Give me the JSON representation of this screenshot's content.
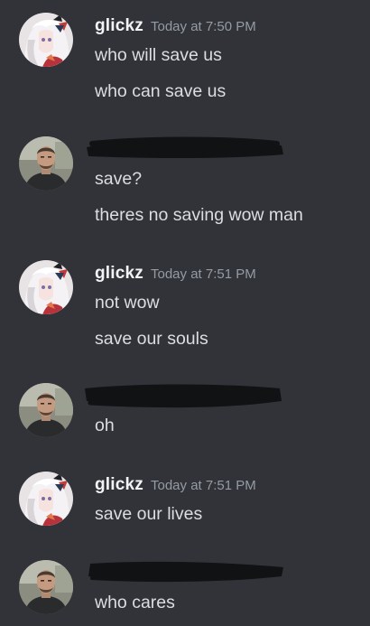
{
  "messages": [
    {
      "author": "glickz",
      "timestamp": "Today at 7:50 PM",
      "avatar": "anime-character-avatar-icon",
      "lines": [
        "who will save us",
        "who can save us"
      ]
    },
    {
      "author": "",
      "timestamp": "",
      "avatar": "man-photo-avatar-icon",
      "lines": [
        "save?",
        "theres no saving wow man"
      ]
    },
    {
      "author": "glickz",
      "timestamp": "Today at 7:51 PM",
      "avatar": "anime-character-avatar-icon",
      "lines": [
        "not wow",
        "save our souls"
      ]
    },
    {
      "author": "",
      "timestamp": "",
      "avatar": "man-photo-avatar-icon",
      "lines": [
        "oh"
      ]
    },
    {
      "author": "glickz",
      "timestamp": "Today at 7:51 PM",
      "avatar": "anime-character-avatar-icon",
      "lines": [
        "save our lives"
      ]
    },
    {
      "author": "",
      "timestamp": "",
      "avatar": "man-photo-avatar-icon",
      "lines": [
        "who cares"
      ]
    }
  ],
  "colors": {
    "background": "#313338",
    "username": "#f2f3f5",
    "timestamp": "#949ba4",
    "message_text": "#dbdee1",
    "redaction": "#111214"
  }
}
